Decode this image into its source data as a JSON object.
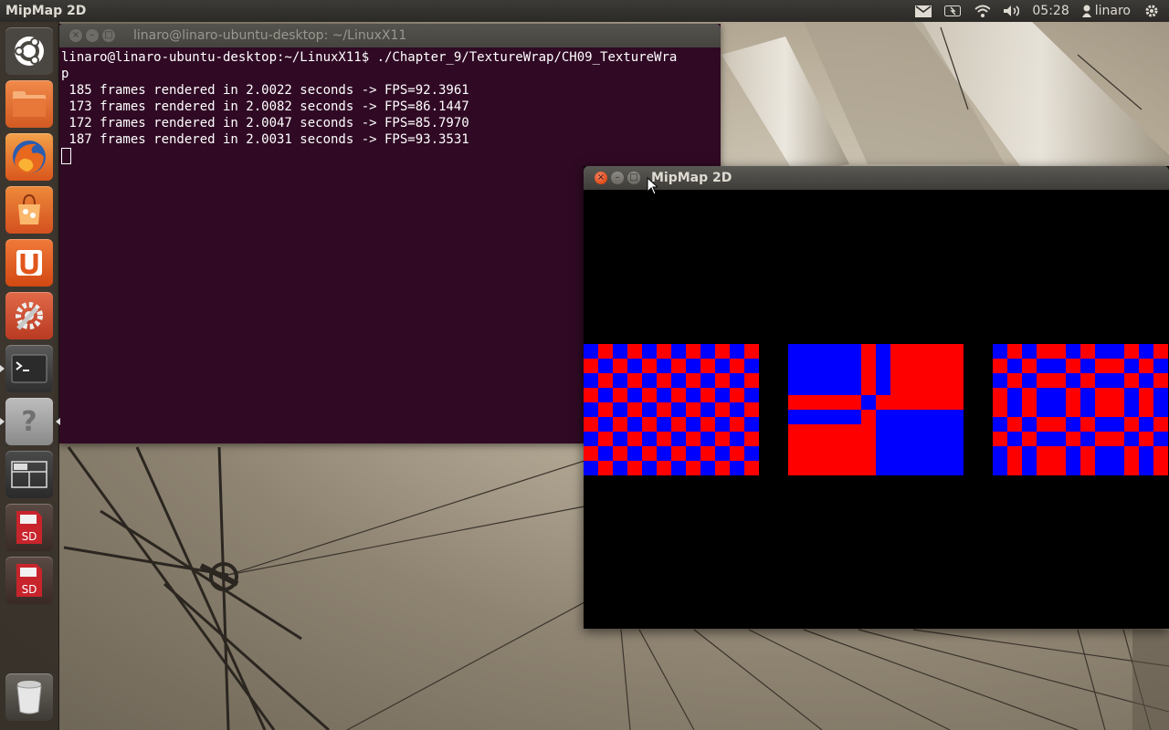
{
  "panel": {
    "app_title": "MipMap 2D",
    "clock": "05:28",
    "username": "linaro",
    "tray_icons": [
      "mail-icon",
      "battery-icon",
      "wifi-icon",
      "volume-icon",
      "user-icon",
      "settings-gear-icon"
    ]
  },
  "launcher": {
    "items": [
      {
        "name": "dash-home-icon",
        "color": "#5e5a55"
      },
      {
        "name": "files-folder-icon",
        "color": "#e0642c"
      },
      {
        "name": "firefox-icon",
        "color": "#e8722a"
      },
      {
        "name": "software-center-icon",
        "color": "#e05f25"
      },
      {
        "name": "ubuntu-one-icon",
        "color": "#e25a1e"
      },
      {
        "name": "system-settings-icon",
        "color": "#c94a30"
      },
      {
        "name": "terminal-icon",
        "color": "#3a3a3a"
      },
      {
        "name": "help-icon",
        "color": "#9a9a9a"
      },
      {
        "name": "workspace-switcher-icon",
        "color": "#3a3a3a"
      },
      {
        "name": "sd-card-icon",
        "color": "#7a1e1e",
        "label": "SD"
      },
      {
        "name": "sd-card-icon",
        "color": "#7a1e1e",
        "label": "SD"
      },
      {
        "name": "trash-icon",
        "color": "#55524c"
      }
    ]
  },
  "terminal": {
    "title": "linaro@linaro-ubuntu-desktop: ~/LinuxX11",
    "lines": [
      "linaro@linaro-ubuntu-desktop:~/LinuxX11$ ./Chapter_9/TextureWrap/CH09_TextureWra",
      "p",
      " 185 frames rendered in 2.0022 seconds -> FPS=92.3961",
      " 173 frames rendered in 2.0082 seconds -> FPS=86.1447",
      " 172 frames rendered in 2.0047 seconds -> FPS=85.7970",
      " 187 frames rendered in 2.0031 seconds -> FPS=93.3531"
    ]
  },
  "mipmap_window": {
    "title": "MipMap 2D",
    "colors": {
      "red": "#ff0000",
      "blue": "#0000ff",
      "background": "#000000"
    }
  }
}
